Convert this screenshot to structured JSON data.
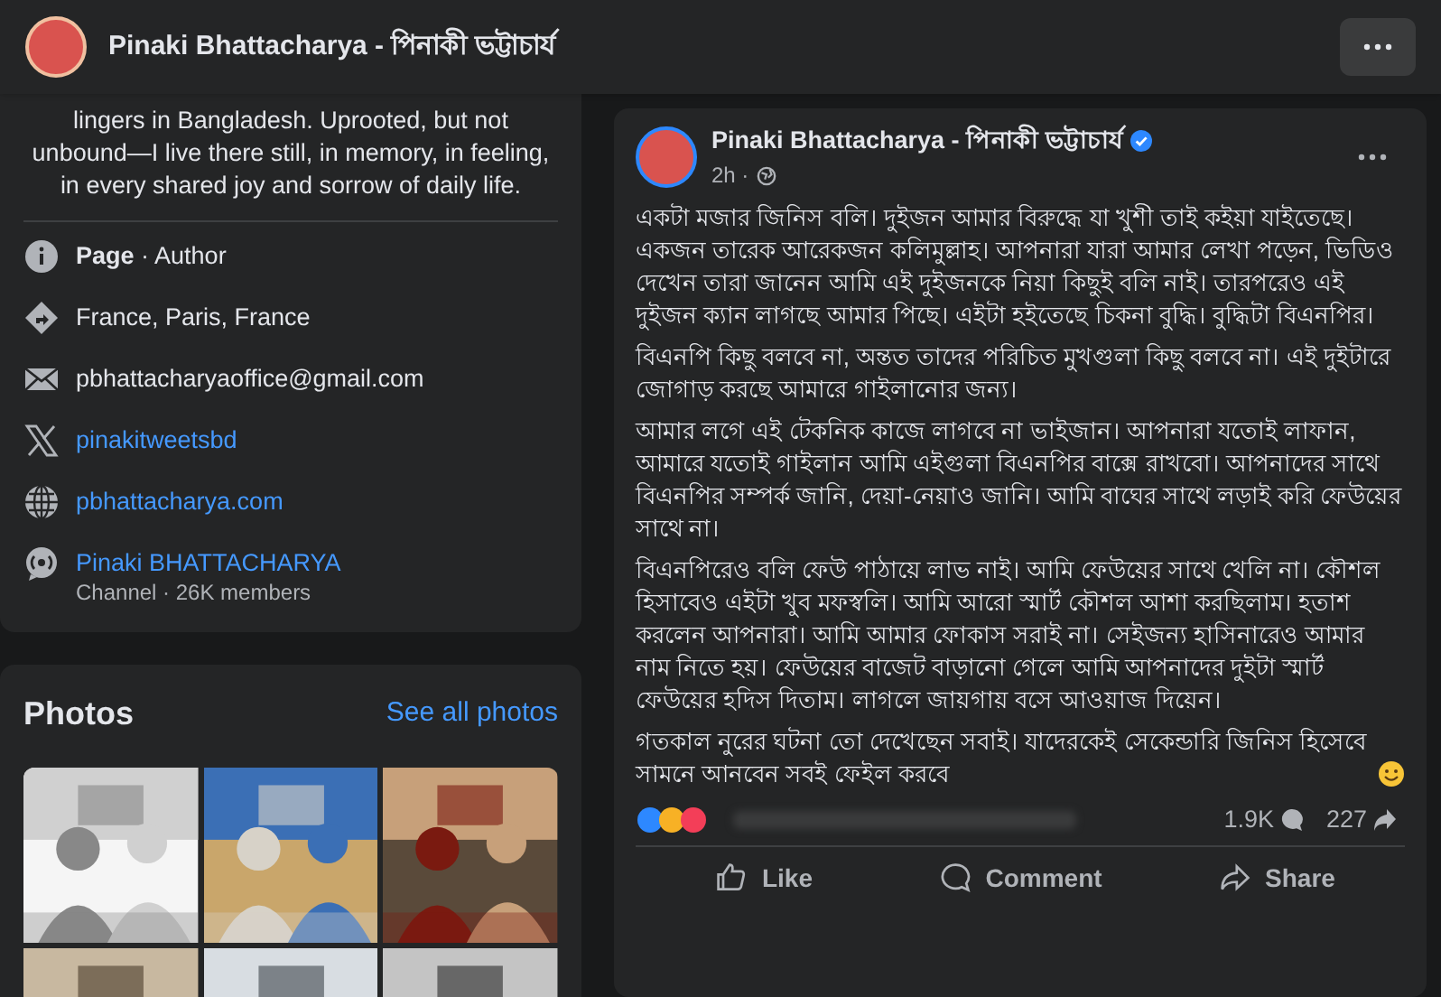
{
  "header": {
    "title": "Pinaki Bhattacharya - পিনাকী ভট্টাচার্য"
  },
  "intro": {
    "bio": "lingers in Bangladesh. Uprooted, but not unbound—I live there still, in memory, in feeling, in every shared joy and sorrow of daily life.",
    "details": [
      {
        "kind": "info",
        "text": "**Page** · Author",
        "link": false
      },
      {
        "kind": "location",
        "text": "France, Paris, France",
        "link": false
      },
      {
        "kind": "email",
        "text": "pbhattacharyaoffice@gmail.com",
        "link": false
      },
      {
        "kind": "x",
        "text": "pinakitweetsbd",
        "link": true
      },
      {
        "kind": "website",
        "text": "pbhattacharya.com",
        "link": true
      },
      {
        "kind": "channel",
        "text": "Pinaki BHATTACHARYA",
        "sub": "Channel · 26K members",
        "link": true
      }
    ]
  },
  "photos": {
    "title": "Photos",
    "see_all": "See all photos"
  },
  "post": {
    "author": "Pinaki Bhattacharya - পিনাকী ভট্টাচার্য",
    "verified": true,
    "time": "2h ·",
    "paragraphs": [
      "একটা মজার জিনিস বলি। দুইজন আমার বিরুদ্ধে যা খুশী তাই কইয়া যাইতেছে। একজন তারেক আরেকজন কলিমুল্লাহ। আপনারা যারা আমার লেখা পড়েন, ভিডিও দেখেন তারা জানেন আমি এই দুইজনকে নিয়া কিছুই বলি নাই। তারপরেও এই দুইজন ক্যান লাগছে আমার পিছে। এইটা হইতেছে চিকনা বুদ্ধি। বুদ্ধিটা বিএনপির।",
      "বিএনপি কিছু বলবে না, অন্তত তাদের পরিচিত মুখগুলা কিছু বলবে না। এই দুইটারে জোগাড় করছে আমারে গাইলানোর জন্য।",
      "আমার লগে এই টেকনিক কাজে লাগবে না ভাইজান। আপনারা যতোই লাফান, আমারে যতোই গাইলান আমি এইগুলা বিএনপির বাক্সে রাখবো। আপনাদের সাথে বিএনপির সম্পর্ক জানি, দেয়া-নেয়াও জানি।  আমি বাঘের সাথে লড়াই করি ফেউয়ের সাথে না।",
      "বিএনপিরেও বলি ফেউ পাঠায়ে লাভ নাই। আমি ফেউয়ের সাথে খেলি না। কৌশল হিসাবেও এইটা খুব মফস্বলি। আমি আরো স্মার্ট কৌশল আশা করছিলাম। হতাশ করলেন আপনারা। আমি আমার ফোকাস সরাই না। সেইজন্য হাসিনারেও আমার নাম নিতে হয়। ফেউয়ের বাজেট বাড়ানো গেলে আমি আপনাদের দুইটা স্মার্ট ফেউয়ের হদিস দিতাম। লাগলে জায়গায় বসে আওয়াজ দিয়েন।",
      "গতকাল নুরের ঘটনা তো দেখেছেন সবাই। যাদেরকেই সেকেন্ডারি জিনিস হিসেবে সামনে আনবেন সবই ফেইল করবে"
    ],
    "comments": "1.9K",
    "shares": "227",
    "actions": [
      {
        "kind": "like",
        "label": "Like"
      },
      {
        "kind": "comment",
        "label": "Comment"
      },
      {
        "kind": "share",
        "label": "Share"
      }
    ]
  }
}
